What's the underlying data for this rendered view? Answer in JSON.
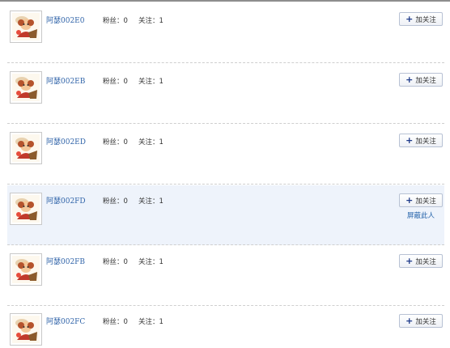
{
  "users": [
    {
      "name": "阿瑟002E0",
      "fans_label": "粉丝：",
      "fans": "0",
      "follows_label": "关注：",
      "follows": "1",
      "follow_label": "加关注",
      "highlighted": false
    },
    {
      "name": "阿瑟002EB",
      "fans_label": "粉丝：",
      "fans": "0",
      "follows_label": "关注：",
      "follows": "1",
      "follow_label": "加关注",
      "highlighted": false
    },
    {
      "name": "阿瑟002ED",
      "fans_label": "粉丝：",
      "fans": "0",
      "follows_label": "关注：",
      "follows": "1",
      "follow_label": "加关注",
      "highlighted": false
    },
    {
      "name": "阿瑟002FD",
      "fans_label": "粉丝：",
      "fans": "0",
      "follows_label": "关注：",
      "follows": "1",
      "follow_label": "加关注",
      "highlighted": true,
      "block_label": "屏蔽此人"
    },
    {
      "name": "阿瑟002FB",
      "fans_label": "粉丝：",
      "fans": "0",
      "follows_label": "关注：",
      "follows": "1",
      "follow_label": "加关注",
      "highlighted": false
    },
    {
      "name": "阿瑟002FC",
      "fans_label": "粉丝：",
      "fans": "0",
      "follows_label": "关注：",
      "follows": "1",
      "follow_label": "加关注",
      "highlighted": false
    }
  ],
  "icons": {
    "avatar": "cartoon-avatar-icon",
    "plus": "plus-icon"
  },
  "colors": {
    "link": "#3366aa",
    "highlight_row": "#eef3fb",
    "divider": "#cfcfcf",
    "plus": "#1e3a8a"
  }
}
